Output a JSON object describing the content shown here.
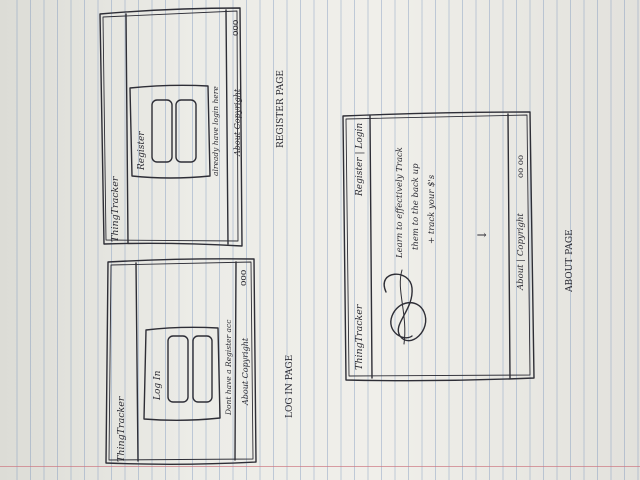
{
  "login_page": {
    "app_name": "ThingTracker",
    "icons_text": "ooo",
    "card_title": "Log In",
    "link_text": "Dont have a Register acc",
    "footer_text": "About Copyright",
    "caption": "LOG IN PAGE"
  },
  "register_page": {
    "app_name": "ThingTracker",
    "icons_text": "ooo",
    "card_title": "Register",
    "link_text": "already have login here",
    "footer_text": "About Copyright",
    "caption": "REGISTER PAGE"
  },
  "about_page": {
    "app_name": "ThingTracker",
    "nav_text": "Register | Login",
    "blurb_lines": [
      "Learn to effectively Track",
      "them to the back up",
      "+ track your $'s"
    ],
    "arrow_text": "↓",
    "footer_text": "About | Copyright",
    "icons_text": "oo oo",
    "caption": "ABOUT PAGE"
  }
}
